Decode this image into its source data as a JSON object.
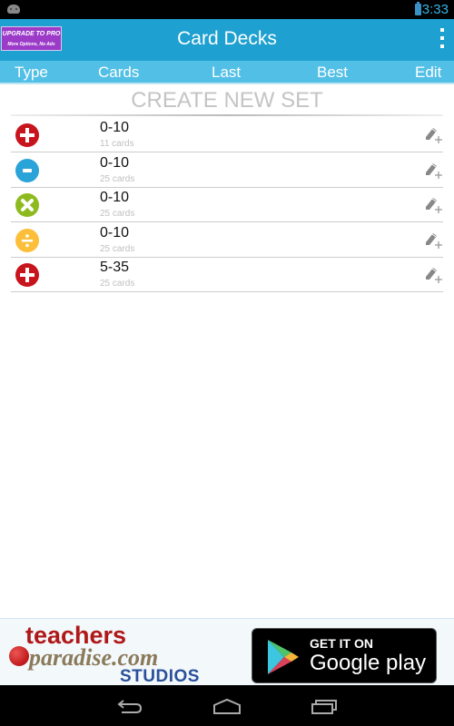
{
  "status_bar": {
    "time": "3:33"
  },
  "action_bar": {
    "upgrade_line1": "UPGRADE TO PRO",
    "upgrade_line2": "More Options, No Ads",
    "title": "Card Decks"
  },
  "columns": [
    "Type",
    "Cards",
    "Last",
    "Best",
    "Edit"
  ],
  "create_label": "CREATE NEW SET",
  "decks": [
    {
      "type": "addition",
      "icon": "plus-icon",
      "color": "#c8141c",
      "range": "0-10",
      "count": "11 cards"
    },
    {
      "type": "subtraction",
      "icon": "minus-icon",
      "color": "#2aa3d8",
      "range": "0-10",
      "count": "25 cards"
    },
    {
      "type": "multiplication",
      "icon": "times-icon",
      "color": "#8dbb1e",
      "range": "0-10",
      "count": "25 cards"
    },
    {
      "type": "division",
      "icon": "divide-icon",
      "color": "#fbbf3a",
      "range": "0-10",
      "count": "25 cards"
    },
    {
      "type": "addition",
      "icon": "plus-icon",
      "color": "#c8141c",
      "range": "5-35",
      "count": "25 cards"
    }
  ],
  "ad": {
    "brand_top": "teachers",
    "brand_mid": "paradise.com",
    "brand_bottom": "STUDIOS",
    "store_line1": "GET IT ON",
    "store_line2": "Google play"
  }
}
